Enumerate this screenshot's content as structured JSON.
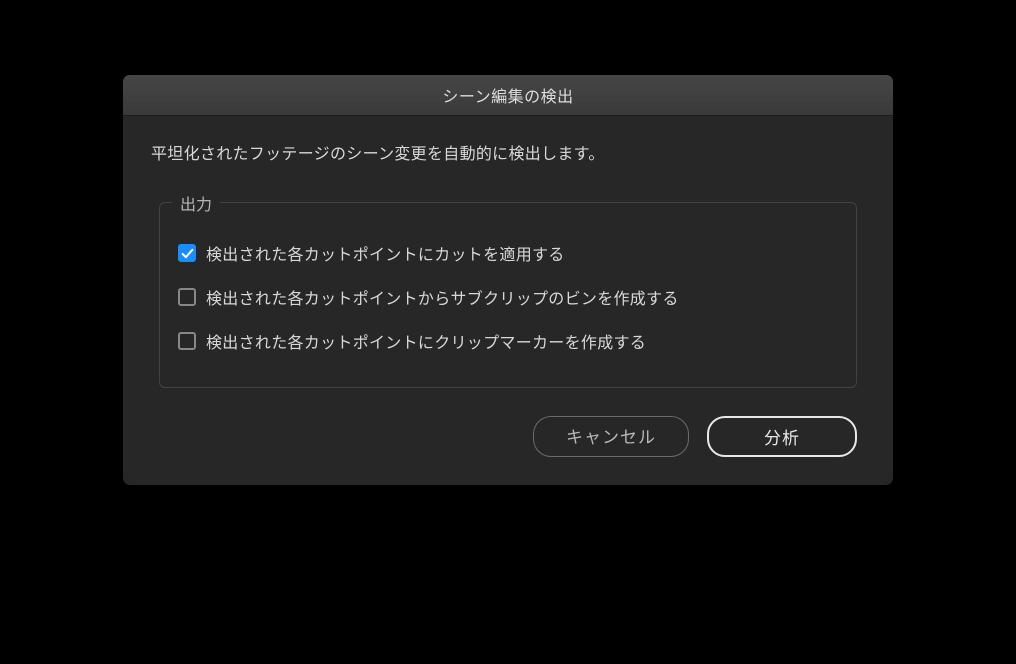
{
  "dialog": {
    "title": "シーン編集の検出",
    "description": "平坦化されたフッテージのシーン変更を自動的に検出します。",
    "output": {
      "legend": "出力",
      "options": [
        {
          "label": "検出された各カットポイントにカットを適用する",
          "checked": true
        },
        {
          "label": "検出された各カットポイントからサブクリップのビンを作成する",
          "checked": false
        },
        {
          "label": "検出された各カットポイントにクリップマーカーを作成する",
          "checked": false
        }
      ]
    },
    "buttons": {
      "cancel": "キャンセル",
      "analyze": "分析"
    }
  }
}
